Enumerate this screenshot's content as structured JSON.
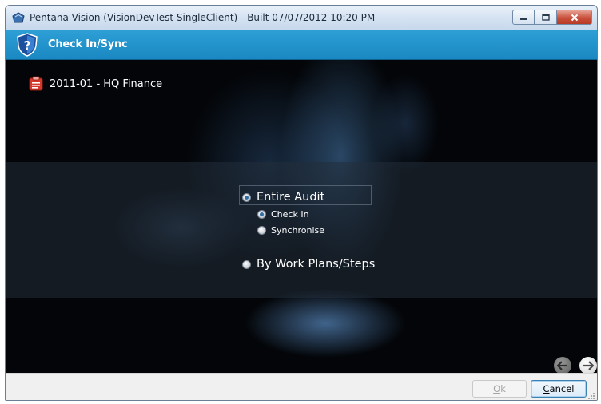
{
  "window": {
    "title": "Pentana Vision (VisionDevTest SingleClient) - Built 07/07/2012 10:20 PM",
    "controls": {
      "minimize": "minimize-icon",
      "maximize": "maximize-icon",
      "close": "close-icon"
    }
  },
  "header": {
    "title": "Check In/Sync",
    "icon": "shield-question-icon"
  },
  "audit": {
    "label": "2011-01 - HQ Finance",
    "icon": "folder-audit-icon"
  },
  "options": {
    "entire_audit": {
      "label": "Entire Audit",
      "selected": true
    },
    "check_in": {
      "label": "Check In",
      "selected": true
    },
    "synchronise": {
      "label": "Synchronise",
      "selected": false
    },
    "by_work_plans": {
      "label": "By Work Plans/Steps",
      "selected": false
    }
  },
  "nav": {
    "prev_icon": "arrow-left-icon",
    "next_icon": "arrow-right-icon"
  },
  "footer": {
    "ok_prefix": "O",
    "ok_rest": "k",
    "cancel_prefix": "C",
    "cancel_rest": "ancel"
  },
  "colors": {
    "accent": "#1a88c2",
    "background": "#030508"
  }
}
